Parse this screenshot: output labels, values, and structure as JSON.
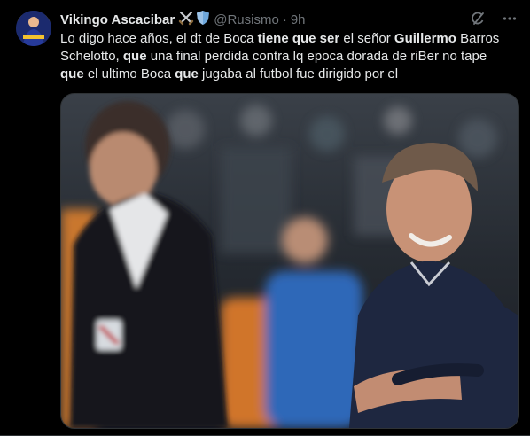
{
  "author": {
    "name": "Vikingo Ascacibar",
    "handle": "@Rusismo",
    "separator": "·",
    "time": "9h"
  },
  "badge_icons": [
    "crossed-swords-icon",
    "shield-icon"
  ],
  "actions": {
    "grok_icon": "grok-icon",
    "more_icon": "more-icon"
  },
  "tweet": {
    "line1_a": "Lo digo hace años, el dt de Boca ",
    "line1_b": "tiene que ser",
    "line1_c": " el señor ",
    "line1_d": "Guillermo",
    "line1_e": " Barros",
    "line2_a": "Schelotto, ",
    "line2_b": "que",
    "line2_c": " una final perdida contra lq epoca dorada de riBer no tape",
    "line3_a": "que",
    "line3_b": " el ultimo Boca ",
    "line3_c": "que",
    "line3_d": " jugaba al futbol fue dirigido por el"
  },
  "colors": {
    "background": "#000000",
    "text": "#e7e9ea",
    "muted": "#71767b",
    "border": "#2f3336"
  }
}
